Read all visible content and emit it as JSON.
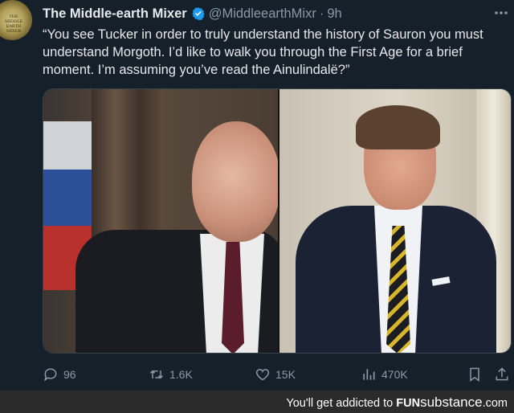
{
  "tweet": {
    "display_name": "The Middle-earth Mixer",
    "handle": "@MiddleearthMixr",
    "separator": "·",
    "time": "9h",
    "text": "“You see Tucker in order to truly understand the history of Sauron you must understand Morgoth. I’d like to walk you through the First Age for a brief moment. I’m assuming you’ve read the Ainulindalë?”",
    "avatar_text": "THE MIDDLE EARTH MIXER",
    "verified_color": "#1d9bf0"
  },
  "actions": {
    "replies": "96",
    "retweets": "1.6K",
    "likes": "15K",
    "views": "470K"
  },
  "footer": {
    "prefix": "You'll get addicted to ",
    "brand_bold": "FUN",
    "brand_rest": "substance",
    "suffix": ".com"
  },
  "icons": [
    "verified-badge-icon",
    "more-icon",
    "reply-icon",
    "retweet-icon",
    "like-icon",
    "views-icon",
    "bookmark-icon",
    "share-icon"
  ]
}
